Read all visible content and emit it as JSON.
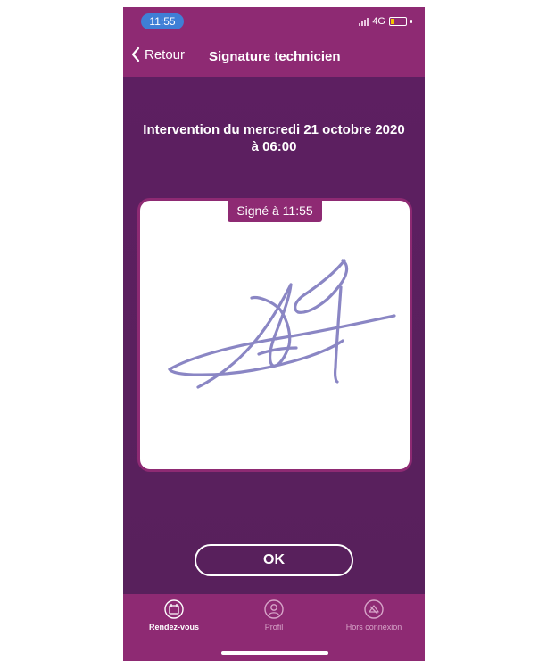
{
  "status_bar": {
    "time": "11:55",
    "network": "4G",
    "icons": [
      "signal-icon",
      "battery-icon"
    ]
  },
  "nav": {
    "back_label": "Retour",
    "title": "Signature technicien",
    "back_icon": "chevron-left-icon"
  },
  "intervention": {
    "title_line1": "Intervention du mercredi 21 octobre 2020",
    "title_line2": "à 06:00"
  },
  "signature": {
    "badge": "Signé à 11:55",
    "stroke_color": "#8a86c4"
  },
  "actions": {
    "ok_label": "OK"
  },
  "tabs": [
    {
      "label": "Rendez-vous",
      "icon": "calendar-icon",
      "active": true
    },
    {
      "label": "Profil",
      "icon": "user-icon",
      "active": false
    },
    {
      "label": "Hors connexion",
      "icon": "offline-icon",
      "active": false
    }
  ],
  "colors": {
    "primary": "#8e2a73",
    "background": "#5a1f5e",
    "status_time_bg": "#3f7fd6"
  }
}
